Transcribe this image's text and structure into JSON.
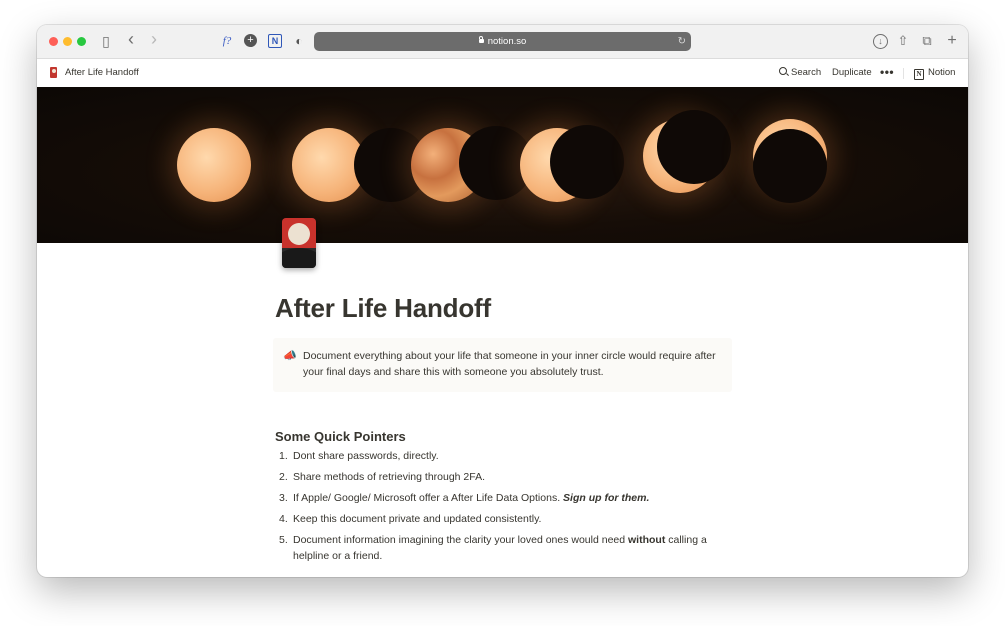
{
  "browser": {
    "url": "notion.so",
    "toolbar_glyphs": {
      "sidebar": "▯",
      "back": "‹",
      "forward": "›",
      "ext_formula": "f?",
      "ext_add": "+",
      "ext_notion": "N",
      "ext_shield": "◐",
      "download": "↓",
      "share": "⇧",
      "tabs": "⧉",
      "new_tab": "+"
    }
  },
  "notion_bar": {
    "page_title": "After Life Handoff",
    "search_label": "Search",
    "duplicate_label": "Duplicate",
    "more_label": "•••",
    "notion_label": "Notion",
    "notion_logo_letter": "N"
  },
  "page": {
    "title": "After Life Handoff",
    "callout": {
      "icon": "📣",
      "text": "Document everything about your life that someone in your inner circle would require after your final days and share this with someone you absolutely trust."
    },
    "section_heading": "Some Quick Pointers",
    "pointers": [
      {
        "num": "1.",
        "text": "Dont share passwords, directly."
      },
      {
        "num": "2.",
        "text": "Share methods of retrieving through 2FA."
      },
      {
        "num": "3.",
        "text": "If Apple/ Google/ Microsoft offer a After Life Data Options. ",
        "emphasis": "Sign up for them."
      },
      {
        "num": "4.",
        "text": "Keep this document private and updated consistently."
      },
      {
        "num": "5.",
        "text": "Document information imagining the clarity your loved ones would need ",
        "bold": "without",
        "text_after": " calling a helpline or a friend."
      }
    ]
  },
  "colors": {
    "text": "#37352f",
    "callout_bg": "#fbfaf7",
    "url_bar": "#6c6c6c",
    "cover_bg": "#0f0906",
    "moon": "#f6b47a"
  }
}
